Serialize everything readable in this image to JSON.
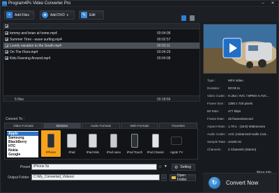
{
  "window": {
    "title": "Program4Pc Video Converter Pro"
  },
  "toolbar": {
    "add_files": "Add Files",
    "add_dvd": "Add DVD",
    "edit": "Edit"
  },
  "files": [
    {
      "name": "tommy and brian at home.mp4",
      "duration": "00:04:08",
      "checked": true,
      "selected": false
    },
    {
      "name": "Summer Time - wave surfing.mp4",
      "duration": "00:02:57",
      "checked": true,
      "selected": false
    },
    {
      "name": "Lovely vacation to the South.mp4",
      "duration": "00:03:11",
      "checked": true,
      "selected": true
    },
    {
      "name": "On The Floor.mp4",
      "duration": "00:04:29",
      "checked": true,
      "selected": false
    },
    {
      "name": "Kids Running Around.mp4",
      "duration": "00:04:08",
      "checked": true,
      "selected": false
    }
  ],
  "footer": {
    "count": "5 files",
    "total": "00:18:56"
  },
  "info": {
    "rows": [
      {
        "k": "Type :",
        "v": "MP4 Video"
      },
      {
        "k": "Duration :",
        "v": "00:03:11"
      },
      {
        "k": "Video Codec :",
        "v": "H.264 / AVC / MPEG-4 AVC..."
      },
      {
        "k": "Frame Size :",
        "v": "1280 x 720 pixels"
      },
      {
        "k": "Bit Rate :",
        "v": "477 kbps"
      },
      {
        "k": "Frame Rate :",
        "v": "25 frames/second"
      },
      {
        "k": "Aspect Ratio :",
        "v": "1.78:1 - (16:9) Widescreen"
      },
      {
        "k": "Audio Codec :",
        "v": "AAC (Advanced Audio Cod..."
      },
      {
        "k": "Sample Rate :",
        "v": "44100 Hz"
      },
      {
        "k": "Channels :",
        "v": "2 Channels (Stereo)"
      }
    ],
    "more": "More info"
  },
  "convert_to": {
    "label": "Convert To :",
    "tabs": [
      "Video Formats",
      "Devices",
      "Audio Formats",
      "Web Formats",
      "Favorites"
    ],
    "brands": [
      "Apple",
      "Samsung",
      "BlackBerry",
      "HTC",
      "Nokia",
      "Google"
    ],
    "devices": [
      "iPhone",
      "iPad",
      "iPad Mini",
      "iPod nano",
      "iPod Touch",
      "iPod Classic",
      "Apple TV"
    ]
  },
  "preset": {
    "label": "Preset :",
    "value": "iPhone 5s",
    "setting": "Setting"
  },
  "output": {
    "label": "Output Folder :",
    "value": "C:\\My_Converted_Videos\\",
    "open": "Open Folder"
  },
  "convert_now": "Convert Now"
}
